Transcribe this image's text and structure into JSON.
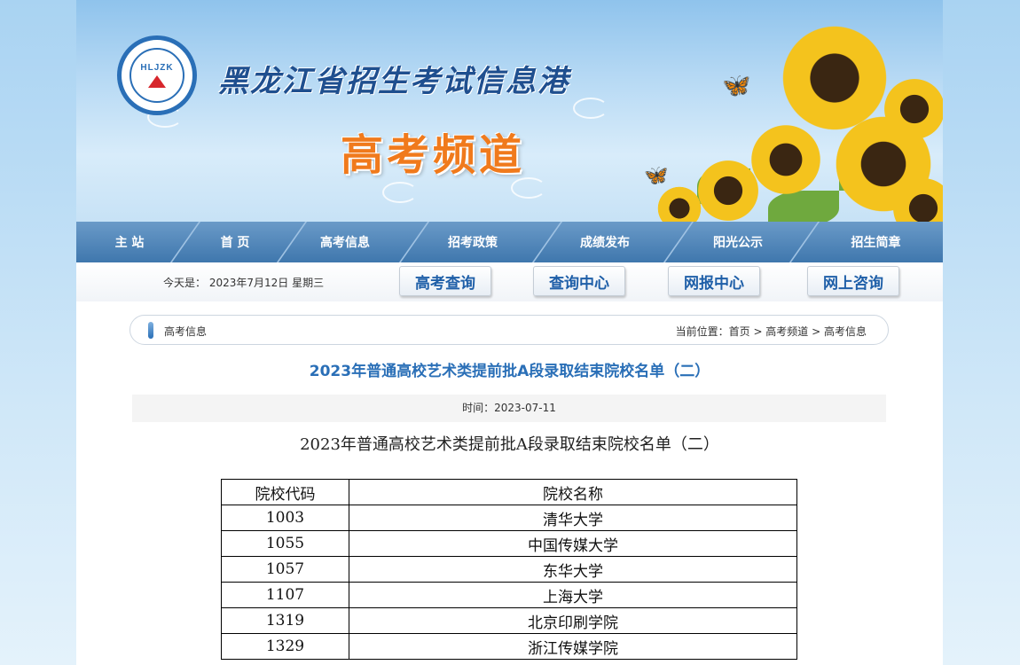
{
  "banner": {
    "logo_text": "HLJZK",
    "site_name": "黑龙江省招生考试信息港",
    "channel_name": "高考频道"
  },
  "nav": {
    "items": [
      {
        "label": "主 站"
      },
      {
        "label": "首 页"
      },
      {
        "label": "高考信息"
      },
      {
        "label": "招考政策"
      },
      {
        "label": "成绩发布"
      },
      {
        "label": "阳光公示"
      },
      {
        "label": "招生简章"
      }
    ]
  },
  "subbar": {
    "date_text": "今天是： 2023年7月12日 星期三",
    "buttons": [
      {
        "label": "高考查询"
      },
      {
        "label": "查询中心"
      },
      {
        "label": "网报中心"
      },
      {
        "label": "网上咨询"
      }
    ]
  },
  "breadcrumb": {
    "section": "高考信息",
    "path": "当前位置：首页 > 高考频道 > 高考信息"
  },
  "article": {
    "title": "2023年普通高校艺术类提前批A段录取结束院校名单（二）",
    "time": "时间：2023-07-11",
    "subtitle": "2023年普通高校艺术类提前批A段录取结束院校名单（二）",
    "table": {
      "headers": [
        "院校代码",
        "院校名称"
      ],
      "rows": [
        [
          "1003",
          "清华大学"
        ],
        [
          "1055",
          "中国传媒大学"
        ],
        [
          "1057",
          "东华大学"
        ],
        [
          "1107",
          "上海大学"
        ],
        [
          "1319",
          "北京印刷学院"
        ],
        [
          "1329",
          "浙江传媒学院"
        ]
      ]
    }
  },
  "colors": {
    "accent": "#2a6fb7",
    "nav_bg": "#3f77ad",
    "channel_orange": "#f07a1c"
  }
}
